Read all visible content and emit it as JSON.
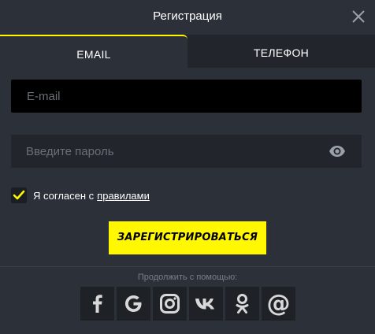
{
  "header": {
    "title": "Регистрация"
  },
  "tabs": [
    {
      "label": "EMAIL",
      "active": true
    },
    {
      "label": "ТЕЛЕФОН",
      "active": false
    }
  ],
  "form": {
    "email_placeholder": "E-mail",
    "email_value": "",
    "password_placeholder": "Введите пароль",
    "password_value": "",
    "agree_checked": true,
    "agree_text": "Я согласен с",
    "agree_link": "правилами",
    "submit_label": "ЗАРЕГИСТРИРОВАТЬСЯ"
  },
  "social": {
    "label": "Продолжить с помощью:",
    "providers": [
      {
        "icon": "facebook-icon"
      },
      {
        "icon": "google-icon"
      },
      {
        "icon": "instagram-icon"
      },
      {
        "icon": "vk-icon"
      },
      {
        "icon": "odnoklassniki-icon"
      },
      {
        "icon": "email-at-icon"
      }
    ]
  },
  "colors": {
    "background": "#2c3038",
    "accent": "#fff800",
    "input_dark": "#000000",
    "input_bg": "#22252b",
    "social_bg": "#1e2126"
  }
}
